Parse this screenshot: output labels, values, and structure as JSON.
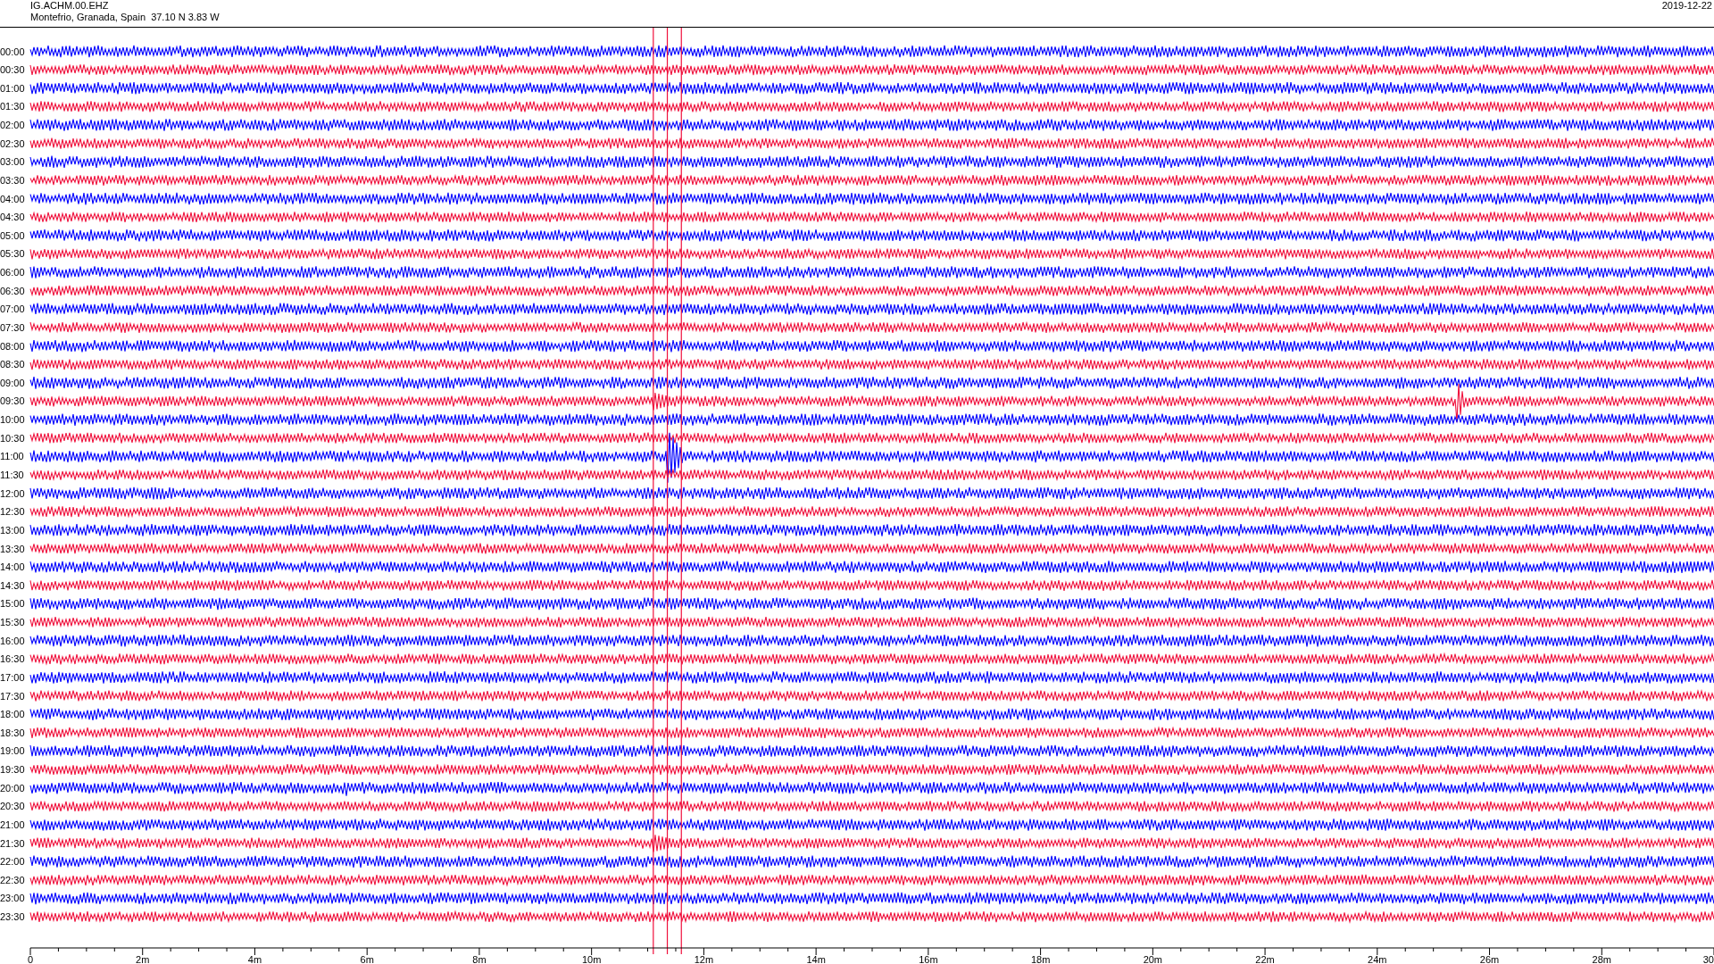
{
  "header": {
    "station": "IG.ACHM.00.EHZ",
    "location": "Montefrio, Granada, Spain  37.10 N 3.83 W",
    "date": "2019-12-22"
  },
  "rows": [
    {
      "time": "00:00",
      "color": "#0000ff"
    },
    {
      "time": "00:30",
      "color": "#f0103c"
    },
    {
      "time": "01:00",
      "color": "#0000ff"
    },
    {
      "time": "01:30",
      "color": "#f0103c"
    },
    {
      "time": "02:00",
      "color": "#0000ff"
    },
    {
      "time": "02:30",
      "color": "#f0103c"
    },
    {
      "time": "03:00",
      "color": "#0000ff"
    },
    {
      "time": "03:30",
      "color": "#f0103c"
    },
    {
      "time": "04:00",
      "color": "#0000ff"
    },
    {
      "time": "04:30",
      "color": "#f0103c"
    },
    {
      "time": "05:00",
      "color": "#0000ff"
    },
    {
      "time": "05:30",
      "color": "#f0103c"
    },
    {
      "time": "06:00",
      "color": "#0000ff"
    },
    {
      "time": "06:30",
      "color": "#f0103c"
    },
    {
      "time": "07:00",
      "color": "#0000ff"
    },
    {
      "time": "07:30",
      "color": "#f0103c"
    },
    {
      "time": "08:00",
      "color": "#0000ff"
    },
    {
      "time": "08:30",
      "color": "#f0103c"
    },
    {
      "time": "09:00",
      "color": "#0000ff"
    },
    {
      "time": "09:30",
      "color": "#f0103c"
    },
    {
      "time": "10:00",
      "color": "#0000ff"
    },
    {
      "time": "10:30",
      "color": "#f0103c"
    },
    {
      "time": "11:00",
      "color": "#0000ff"
    },
    {
      "time": "11:30",
      "color": "#f0103c"
    },
    {
      "time": "12:00",
      "color": "#0000ff"
    },
    {
      "time": "12:30",
      "color": "#f0103c"
    },
    {
      "time": "13:00",
      "color": "#0000ff"
    },
    {
      "time": "13:30",
      "color": "#f0103c"
    },
    {
      "time": "14:00",
      "color": "#0000ff"
    },
    {
      "time": "14:30",
      "color": "#f0103c"
    },
    {
      "time": "15:00",
      "color": "#0000ff"
    },
    {
      "time": "15:30",
      "color": "#f0103c"
    },
    {
      "time": "16:00",
      "color": "#0000ff"
    },
    {
      "time": "16:30",
      "color": "#f0103c"
    },
    {
      "time": "17:00",
      "color": "#0000ff"
    },
    {
      "time": "17:30",
      "color": "#f0103c"
    },
    {
      "time": "18:00",
      "color": "#0000ff"
    },
    {
      "time": "18:30",
      "color": "#f0103c"
    },
    {
      "time": "19:00",
      "color": "#0000ff"
    },
    {
      "time": "19:30",
      "color": "#f0103c"
    },
    {
      "time": "20:00",
      "color": "#0000ff"
    },
    {
      "time": "20:30",
      "color": "#f0103c"
    },
    {
      "time": "21:00",
      "color": "#0000ff"
    },
    {
      "time": "21:30",
      "color": "#f0103c"
    },
    {
      "time": "22:00",
      "color": "#0000ff"
    },
    {
      "time": "22:30",
      "color": "#f0103c"
    },
    {
      "time": "23:00",
      "color": "#0000ff"
    },
    {
      "time": "23:30",
      "color": "#f0103c"
    }
  ],
  "x_axis": {
    "ticks": [
      "0",
      "2m",
      "4m",
      "6m",
      "8m",
      "10m",
      "12m",
      "14m",
      "16m",
      "18m",
      "20m",
      "22m",
      "24m",
      "26m",
      "28m",
      "30"
    ]
  }
}
